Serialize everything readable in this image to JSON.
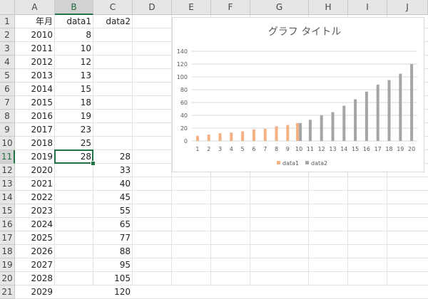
{
  "sheet": {
    "columns": [
      "A",
      "B",
      "C",
      "D",
      "E",
      "F",
      "G",
      "H",
      "I",
      "J"
    ],
    "selected_column": "B",
    "selected_row": 11,
    "rows": [
      {
        "num": "1",
        "a": "年月",
        "b": "data1",
        "c": "data2"
      },
      {
        "num": "2",
        "a": "2010",
        "b": "8",
        "c": ""
      },
      {
        "num": "3",
        "a": "2011",
        "b": "10",
        "c": ""
      },
      {
        "num": "4",
        "a": "2012",
        "b": "12",
        "c": ""
      },
      {
        "num": "5",
        "a": "2013",
        "b": "13",
        "c": ""
      },
      {
        "num": "6",
        "a": "2014",
        "b": "15",
        "c": ""
      },
      {
        "num": "7",
        "a": "2015",
        "b": "18",
        "c": ""
      },
      {
        "num": "8",
        "a": "2016",
        "b": "19",
        "c": ""
      },
      {
        "num": "9",
        "a": "2017",
        "b": "23",
        "c": ""
      },
      {
        "num": "10",
        "a": "2018",
        "b": "25",
        "c": ""
      },
      {
        "num": "11",
        "a": "2019",
        "b": "28",
        "c": "28"
      },
      {
        "num": "12",
        "a": "2020",
        "b": "",
        "c": "33"
      },
      {
        "num": "13",
        "a": "2021",
        "b": "",
        "c": "40"
      },
      {
        "num": "14",
        "a": "2022",
        "b": "",
        "c": "45"
      },
      {
        "num": "15",
        "a": "2023",
        "b": "",
        "c": "55"
      },
      {
        "num": "16",
        "a": "2024",
        "b": "",
        "c": "65"
      },
      {
        "num": "17",
        "a": "2025",
        "b": "",
        "c": "77"
      },
      {
        "num": "18",
        "a": "2026",
        "b": "",
        "c": "88"
      },
      {
        "num": "19",
        "a": "2027",
        "b": "",
        "c": "95"
      },
      {
        "num": "20",
        "a": "2028",
        "b": "",
        "c": "105"
      },
      {
        "num": "21",
        "a": "2029",
        "b": "",
        "c": "120"
      }
    ]
  },
  "chart_data": {
    "type": "bar",
    "title": "グラフ タイトル",
    "categories": [
      "1",
      "2",
      "3",
      "4",
      "5",
      "6",
      "7",
      "8",
      "9",
      "10",
      "11",
      "12",
      "13",
      "14",
      "15",
      "16",
      "17",
      "18",
      "19",
      "20"
    ],
    "series": [
      {
        "name": "data1",
        "color": "#f4b183",
        "values": [
          8,
          10,
          12,
          13,
          15,
          18,
          19,
          23,
          25,
          28,
          null,
          null,
          null,
          null,
          null,
          null,
          null,
          null,
          null,
          null
        ]
      },
      {
        "name": "data2",
        "color": "#a5a5a5",
        "values": [
          null,
          null,
          null,
          null,
          null,
          null,
          null,
          null,
          null,
          28,
          33,
          40,
          45,
          55,
          65,
          77,
          88,
          95,
          105,
          120
        ]
      }
    ],
    "yticks": [
      "0",
      "20",
      "40",
      "60",
      "80",
      "100",
      "120",
      "140"
    ],
    "ylim": [
      0,
      140
    ],
    "grid": true,
    "legend": "bottom"
  }
}
